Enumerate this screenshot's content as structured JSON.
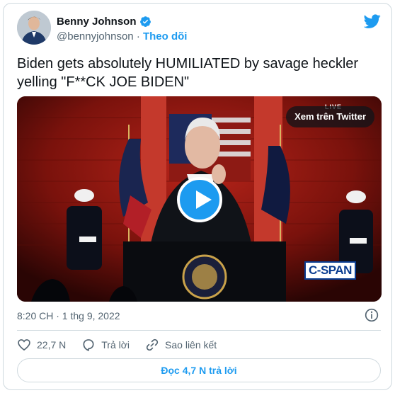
{
  "author": {
    "name": "Benny Johnson",
    "handle": "@bennyjohnson",
    "separator": "·",
    "follow_label": "Theo dõi"
  },
  "tweet": {
    "text": "Biden gets absolutely HUMILIATED by savage heckler yelling \"F**CK JOE BIDEN\""
  },
  "media": {
    "watch_label": "Xem trên Twitter",
    "live_label": "LIVE",
    "channel_label": "C-SPAN"
  },
  "meta": {
    "timestamp": "8:20 CH · 1 thg 9, 2022"
  },
  "actions": {
    "like_count": "22,7 N",
    "reply_label": "Trả lời",
    "copy_link_label": "Sao liên kết"
  },
  "read_replies_label": "Đọc 4,7 N trả lời",
  "colors": {
    "accent": "#1d9bf0",
    "text": "#0f1419",
    "muted": "#536471",
    "border": "#cfd9de"
  }
}
